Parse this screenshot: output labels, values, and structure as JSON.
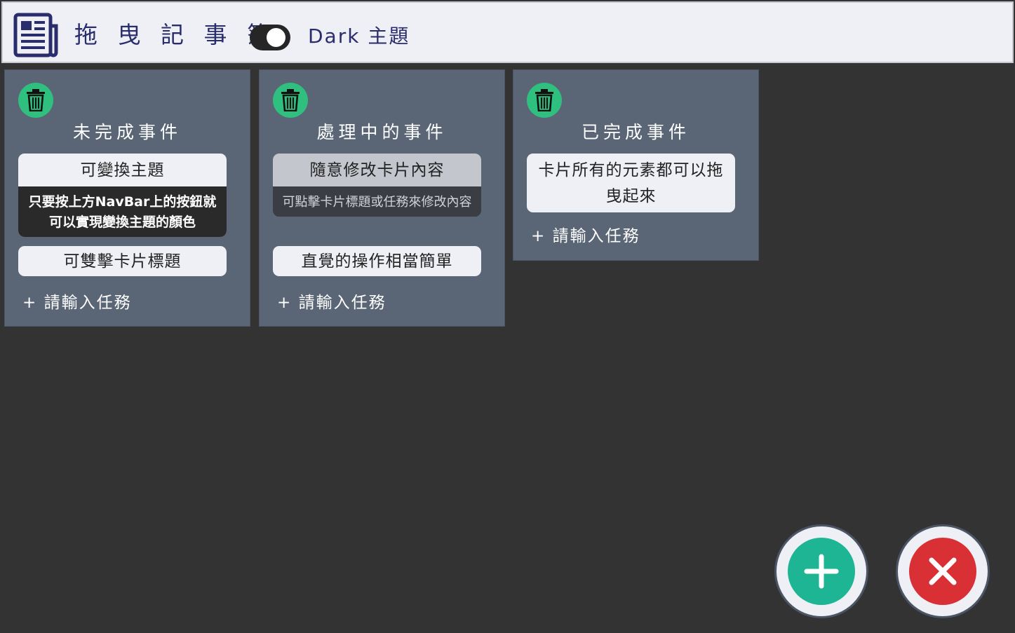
{
  "navbar": {
    "title": "拖 曳 記 事 簿",
    "logo_icon": "newspaper-icon",
    "theme_toggle_on": true,
    "theme_label": "Dark 主題"
  },
  "colors": {
    "navbar_bg": "#eff0f5",
    "page_bg": "#333333",
    "column_bg": "#5a6576",
    "trash_green": "#2fbf7f",
    "add_button_green": "#1db593",
    "close_button_red": "#d93035",
    "title_navy": "#2a2d6b"
  },
  "columns": [
    {
      "title": "未完成事件",
      "trash_icon": "trash-icon",
      "cards": [
        {
          "title": "可變換主題",
          "body": "只要按上方NavBar上的按鈕就可以實現變換主題的顏色"
        },
        {
          "title": "可雙擊卡片標題"
        }
      ],
      "add_task_label": "+ 請輸入任務"
    },
    {
      "title": "處理中的事件",
      "trash_icon": "trash-icon",
      "cards": [
        {
          "title": "隨意修改卡片內容",
          "body": "可點擊卡片標題或任務來修改內容"
        },
        {
          "title": "直覺的操作相當簡單"
        }
      ],
      "add_task_label": "+ 請輸入任務"
    },
    {
      "title": "已完成事件",
      "trash_icon": "trash-icon",
      "cards": [
        {
          "title": "卡片所有的元素都可以拖曳起來"
        }
      ],
      "add_task_label": "+ 請輸入任務"
    }
  ],
  "fab": {
    "add_icon": "plus-icon",
    "close_icon": "close-icon"
  }
}
